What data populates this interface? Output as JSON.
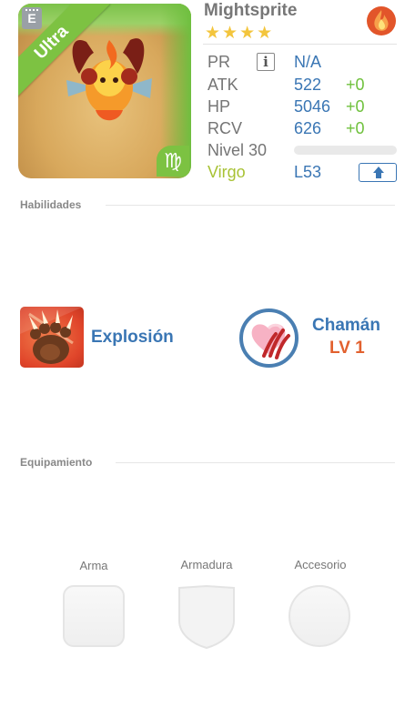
{
  "monster": {
    "name": "Mightsprite",
    "stars": "★★★★",
    "rarity_ribbon": "Ultra",
    "card_corner_badge": "E",
    "zodiac_symbol": "♍",
    "element_icon": "fire-icon"
  },
  "stats": {
    "pr": {
      "label": "PR",
      "value": "N/A",
      "info": "i"
    },
    "atk": {
      "label": "ATK",
      "value": "522",
      "bonus": "+0"
    },
    "hp": {
      "label": "HP",
      "value": "5046",
      "bonus": "+0"
    },
    "rcv": {
      "label": "RCV",
      "value": "626",
      "bonus": "+0"
    },
    "level": {
      "label": "Nivel 30",
      "progress": 0
    },
    "sign": {
      "label": "Virgo",
      "value": "L53"
    }
  },
  "sections": {
    "skills_title": "Habilidades",
    "equipment_title": "Equipamiento"
  },
  "skills": {
    "active": {
      "name": "Explosión",
      "icon": "claw-paw-icon"
    },
    "leader": {
      "name": "Chamán",
      "level": "LV 1",
      "icon": "scratched-heart-icon"
    }
  },
  "equipment": {
    "slots": [
      {
        "label": "Arma",
        "shape": "rounded-square"
      },
      {
        "label": "Armadura",
        "shape": "shield"
      },
      {
        "label": "Accesorio",
        "shape": "circle"
      }
    ]
  },
  "colors": {
    "accent_blue": "#3a76b4",
    "bonus_green": "#6fc13c",
    "ribbon_green": "#7dc242",
    "star_gold": "#f3c53d",
    "leader_level_orange": "#e2612f",
    "virgo_yellowgreen": "#a8c234"
  }
}
